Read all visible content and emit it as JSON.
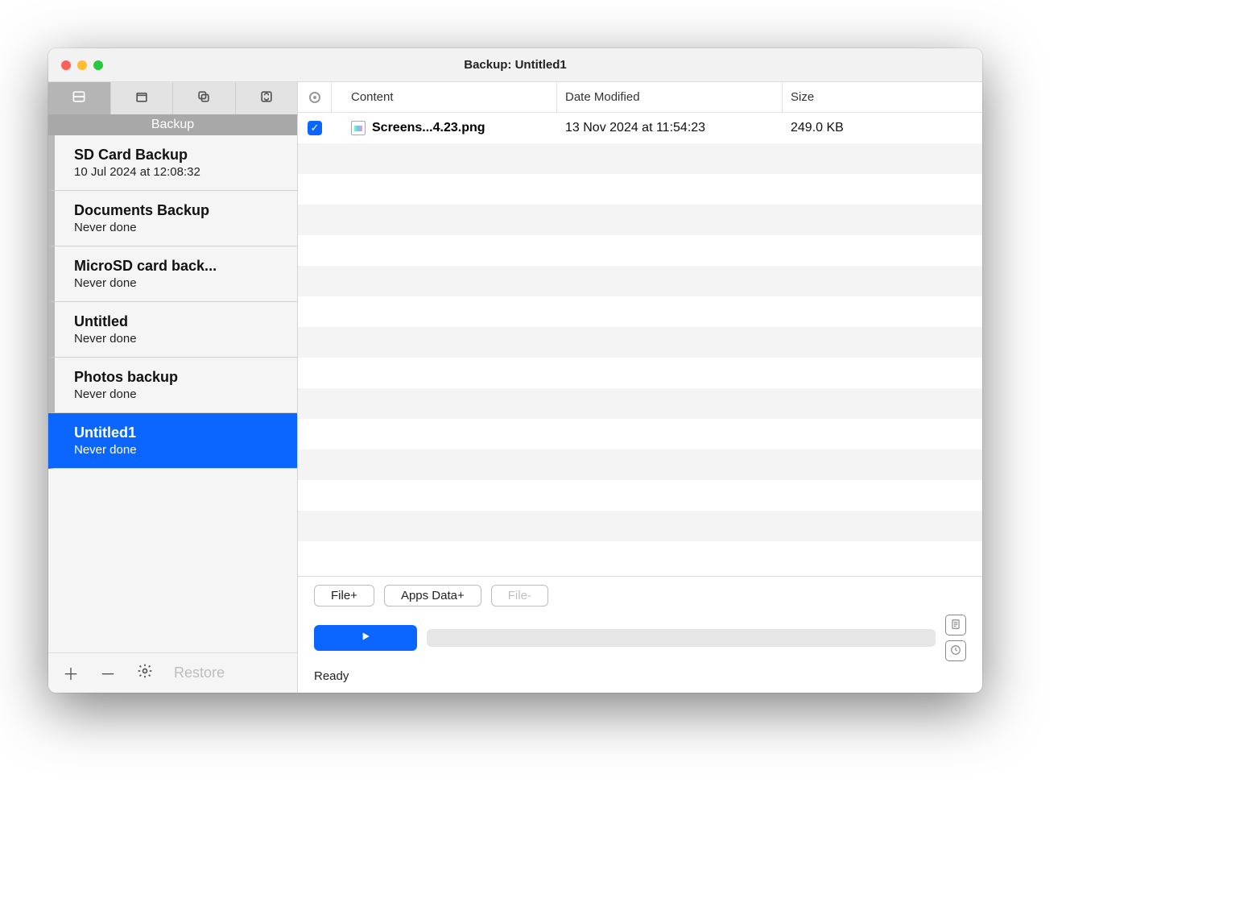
{
  "window": {
    "title": "Backup: Untitled1"
  },
  "sidebar": {
    "header": "Backup",
    "items": [
      {
        "title": "SD Card Backup",
        "sub": "10 Jul 2024 at 12:08:32",
        "selected": false
      },
      {
        "title": "Documents Backup",
        "sub": "Never done",
        "selected": false
      },
      {
        "title": "MicroSD card back...",
        "sub": "Never done",
        "selected": false
      },
      {
        "title": "Untitled",
        "sub": "Never done",
        "selected": false
      },
      {
        "title": "Photos backup",
        "sub": "Never done",
        "selected": false
      },
      {
        "title": "Untitled1",
        "sub": "Never done",
        "selected": true
      }
    ],
    "footer": {
      "restore": "Restore"
    }
  },
  "columns": {
    "content": "Content",
    "date": "Date Modified",
    "size": "Size"
  },
  "files": [
    {
      "name": "Screens...4.23.png",
      "date": "13 Nov 2024 at 11:54:23",
      "size": "249.0 KB",
      "checked": true
    }
  ],
  "buttons": {
    "file_plus": "File+",
    "apps_data_plus": "Apps Data+",
    "file_minus": "File-"
  },
  "status": "Ready"
}
